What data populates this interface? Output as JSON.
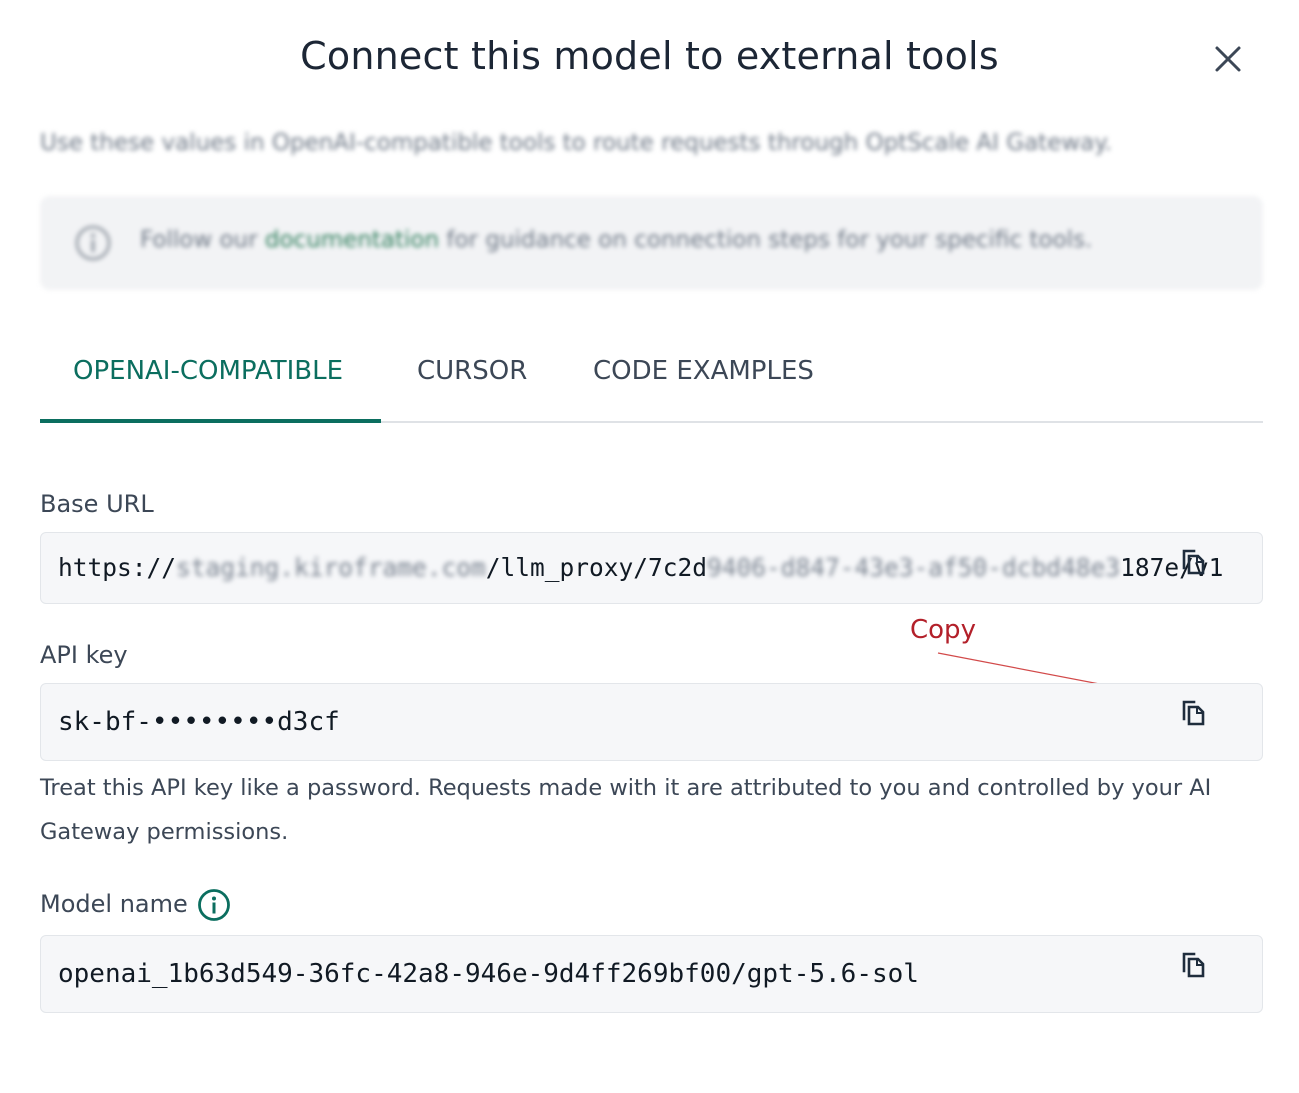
{
  "dialog": {
    "title": "Connect this model to external tools",
    "subtitle": "Use these values in OpenAI-compatible tools to route requests through OptScale AI Gateway.",
    "info": {
      "text_before": "Follow our ",
      "link": "documentation",
      "text_after": " for guidance on connection steps for your specific tools."
    }
  },
  "tabs": [
    {
      "label": "OPENAI-COMPATIBLE",
      "active": true
    },
    {
      "label": "CURSOR",
      "active": false
    },
    {
      "label": "CODE EXAMPLES",
      "active": false
    }
  ],
  "fields": {
    "base_url": {
      "label": "Base URL",
      "value_prefix": "https://",
      "value_blur_1": "staging.kiroframe.com",
      "value_mid": "/llm_proxy/7c2d",
      "value_blur_2": "9406-d847-43e3-af50-dcbd48e3",
      "value_suffix": "187e/v1"
    },
    "api_key": {
      "label": "API key",
      "value": "sk-bf-••••••••d3cf",
      "hint": "Treat this API key like a password. Requests made with it are attributed to you and controlled by your AI Gateway permissions."
    },
    "model_name": {
      "label": "Model name",
      "value": "openai_1b63d549-36fc-42a8-946e-9d4ff269bf00/gpt-5.6-sol"
    }
  },
  "annotation": {
    "label": "Copy"
  },
  "colors": {
    "accent": "#0b6e5f",
    "annotation": "#b3202a",
    "field_bg": "#f6f7f9"
  },
  "icons": {
    "close": "close-icon",
    "info": "info-circle-icon",
    "copy": "copy-icon"
  }
}
